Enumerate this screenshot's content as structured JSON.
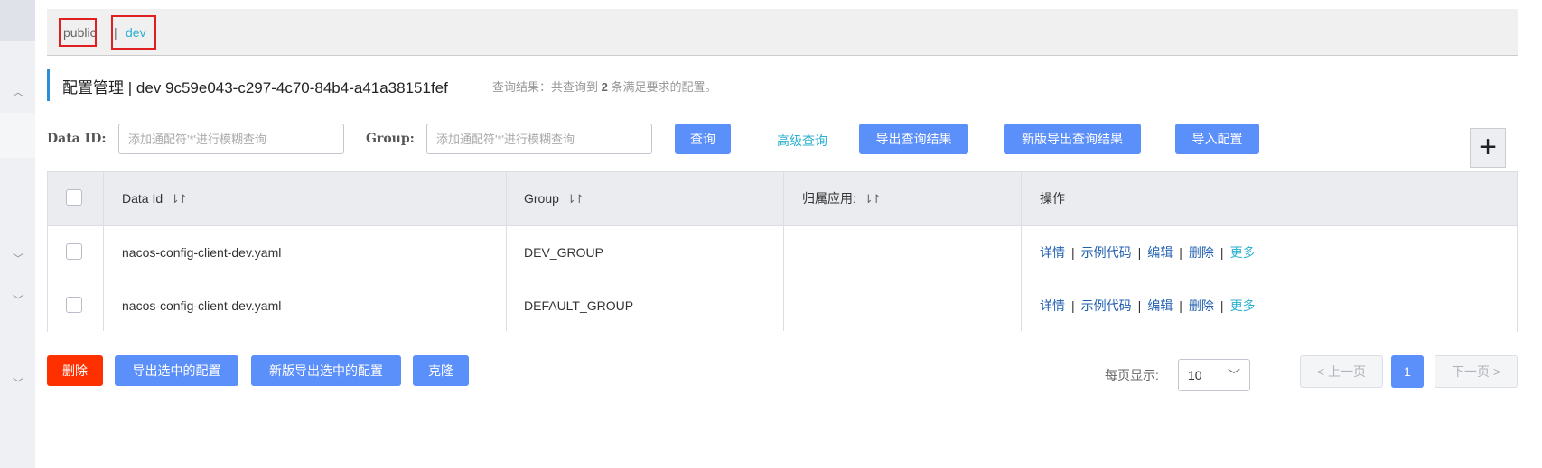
{
  "namespaces": {
    "public_label": "public",
    "separator": "|",
    "dev_label": "dev"
  },
  "title": {
    "main": "配置管理  |  dev  9c59e043-c297-4c70-84b4-a41a38151fef",
    "result_prefix": "查询结果：共查询到",
    "result_count": "2",
    "result_suffix": "条满足要求的配置。"
  },
  "search": {
    "data_id_label": "Data ID:",
    "data_id_placeholder": "添加通配符'*'进行模糊查询",
    "group_label": "Group:",
    "group_placeholder": "添加通配符'*'进行模糊查询",
    "query_button": "查询",
    "advanced_link": "高级查询",
    "export_button": "导出查询结果",
    "new_export_button": "新版导出查询结果",
    "import_button": "导入配置",
    "add_icon": "plus-icon"
  },
  "table": {
    "headers": {
      "data_id": "Data Id",
      "group": "Group",
      "app": "归属应用:",
      "actions": "操作"
    },
    "sort_icon": "⇂↾",
    "rows": [
      {
        "data_id": "nacos-config-client-dev.yaml",
        "group": "DEV_GROUP",
        "app": ""
      },
      {
        "data_id": "nacos-config-client-dev.yaml",
        "group": "DEFAULT_GROUP",
        "app": ""
      }
    ],
    "actions": {
      "detail": "详情",
      "sample": "示例代码",
      "edit": "编辑",
      "delete": "删除",
      "more": "更多",
      "separator": "|"
    }
  },
  "bulk": {
    "delete": "删除",
    "export_selected": "导出选中的配置",
    "new_export_selected": "新版导出选中的配置",
    "clone": "克隆"
  },
  "pagination": {
    "page_size_label": "每页显示:",
    "page_size": "10",
    "prev": "< 上一页",
    "current_page": "1",
    "next": "下一页 >"
  },
  "colors": {
    "primary": "#5b8ff9",
    "danger": "#ff3000",
    "link": "#1f5fb0",
    "accent": "#2ab0d0",
    "highlight_box": "#e02020"
  }
}
